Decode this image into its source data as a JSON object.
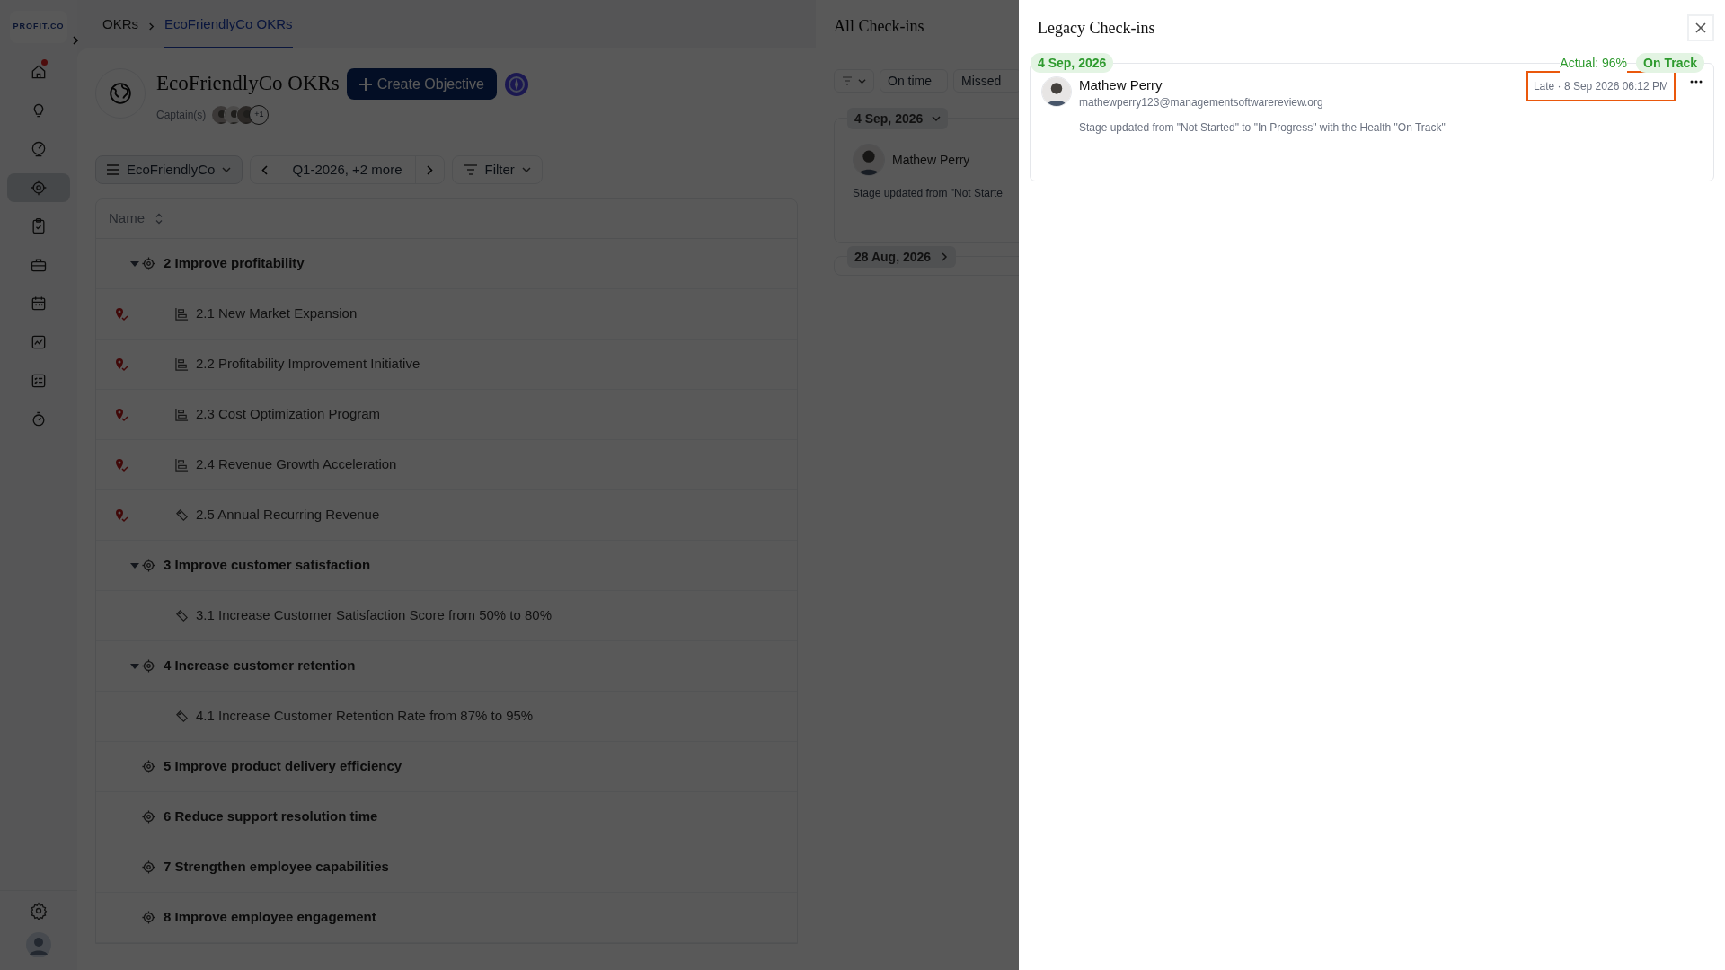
{
  "logo": {
    "text": "PROFIT.CO"
  },
  "sidebar": {
    "items": [
      {
        "kind": "home",
        "selected": false,
        "badge": true
      },
      {
        "kind": "bulb",
        "selected": false,
        "badge": false
      },
      {
        "kind": "gauge",
        "selected": false,
        "badge": false
      },
      {
        "kind": "target",
        "selected": true,
        "badge": false
      },
      {
        "kind": "clipboard",
        "selected": false,
        "badge": false
      },
      {
        "kind": "briefcase",
        "selected": false,
        "badge": false
      },
      {
        "kind": "calendar",
        "selected": false,
        "badge": false
      },
      {
        "kind": "chart",
        "selected": false,
        "badge": false
      },
      {
        "kind": "checklist",
        "selected": false,
        "badge": false
      },
      {
        "kind": "timer",
        "selected": false,
        "badge": false
      }
    ]
  },
  "breadcrumbs": [
    {
      "label": "OKRs",
      "selected": false
    },
    {
      "label": "EcoFriendlyCo OKRs",
      "selected": true
    }
  ],
  "page": {
    "title": "EcoFriendlyCo OKRs",
    "create_button": "Create Objective",
    "captains_label": "Captain(s)",
    "captains_more": "+1"
  },
  "toolbar": {
    "group": "EcoFriendlyCo",
    "period": "Q1-2026, +2 more",
    "filter": "Filter"
  },
  "table": {
    "columns": [
      "Name"
    ],
    "rows": [
      {
        "kind": "objective",
        "label": "2 Improve profitability",
        "expanded": true,
        "children": [
          {
            "kind": "initiative",
            "label": "2.1 New Market Expansion",
            "pinned": true
          },
          {
            "kind": "initiative",
            "label": "2.2 Profitability Improvement Initiative",
            "pinned": true
          },
          {
            "kind": "initiative",
            "label": "2.3 Cost Optimization Program",
            "pinned": true
          },
          {
            "kind": "initiative",
            "label": "2.4 Revenue Growth Acceleration",
            "pinned": true
          },
          {
            "kind": "metric",
            "label": "2.5 Annual Recurring Revenue",
            "pinned": true
          }
        ]
      },
      {
        "kind": "objective",
        "label": "3 Improve customer satisfaction",
        "expanded": true,
        "children": [
          {
            "kind": "metric",
            "label": "3.1 Increase Customer Satisfaction Score from 50% to 80%",
            "pinned": false
          }
        ]
      },
      {
        "kind": "objective",
        "label": "4 Increase customer retention",
        "expanded": true,
        "children": [
          {
            "kind": "metric",
            "label": "4.1 Increase Customer Retention Rate from 87% to 95%",
            "pinned": false
          }
        ]
      },
      {
        "kind": "objective",
        "label": "5 Improve product delivery efficiency"
      },
      {
        "kind": "objective",
        "label": "6 Reduce support resolution time"
      },
      {
        "kind": "objective",
        "label": "7 Strengthen employee capabilities"
      },
      {
        "kind": "objective",
        "label": "8 Improve employee engagement"
      }
    ]
  },
  "all_checkins": {
    "title": "All Check-ins",
    "filters": [
      "On time",
      "Missed"
    ],
    "groups": [
      {
        "date": "4 Sep, 2026",
        "expanded": true,
        "entries": [
          {
            "name": "Mathew Perry",
            "message": "Stage updated from \"Not Starte"
          }
        ]
      },
      {
        "date": "28 Aug, 2026",
        "expanded": false
      }
    ]
  },
  "legacy_checkins": {
    "title": "Legacy Check-ins",
    "entries": [
      {
        "date": "4 Sep, 2026",
        "actual": "Actual: 96%",
        "health": "On Track",
        "name": "Mathew Perry",
        "email": "mathewperry123@managementsoftwarereview.org",
        "timestamp": "Late · 8 Sep 2026 06:12 PM",
        "highlighted": true,
        "message": "Stage updated from \"Not Started\" to \"In Progress\" with the Health \"On Track\""
      }
    ]
  }
}
